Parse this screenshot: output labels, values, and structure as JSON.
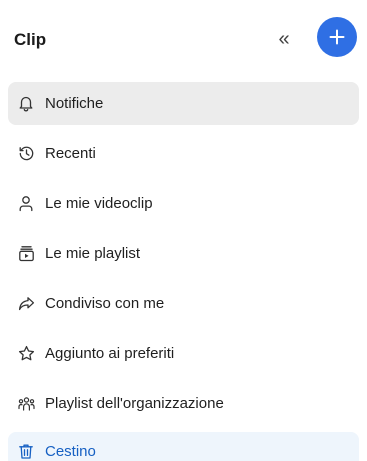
{
  "header": {
    "title": "Clip",
    "collapse_icon": "double-chevron-left-icon",
    "collapse_glyph": "«",
    "add_icon": "plus-icon",
    "accent_color": "#2f6fe4"
  },
  "nav": {
    "items": [
      {
        "label": "Notifiche",
        "icon": "bell-icon",
        "state": "selected"
      },
      {
        "label": "Recenti",
        "icon": "history-icon"
      },
      {
        "label": "Le mie videoclip",
        "icon": "person-icon"
      },
      {
        "label": "Le mie playlist",
        "icon": "playlist-icon"
      },
      {
        "label": "Condiviso con me",
        "icon": "share-icon"
      },
      {
        "label": "Aggiunto ai preferiti",
        "icon": "star-icon"
      },
      {
        "label": "Playlist dell'organizzazione",
        "icon": "people-group-icon"
      },
      {
        "label": "Cestino",
        "icon": "trash-icon",
        "color": "#1660c3"
      }
    ]
  }
}
